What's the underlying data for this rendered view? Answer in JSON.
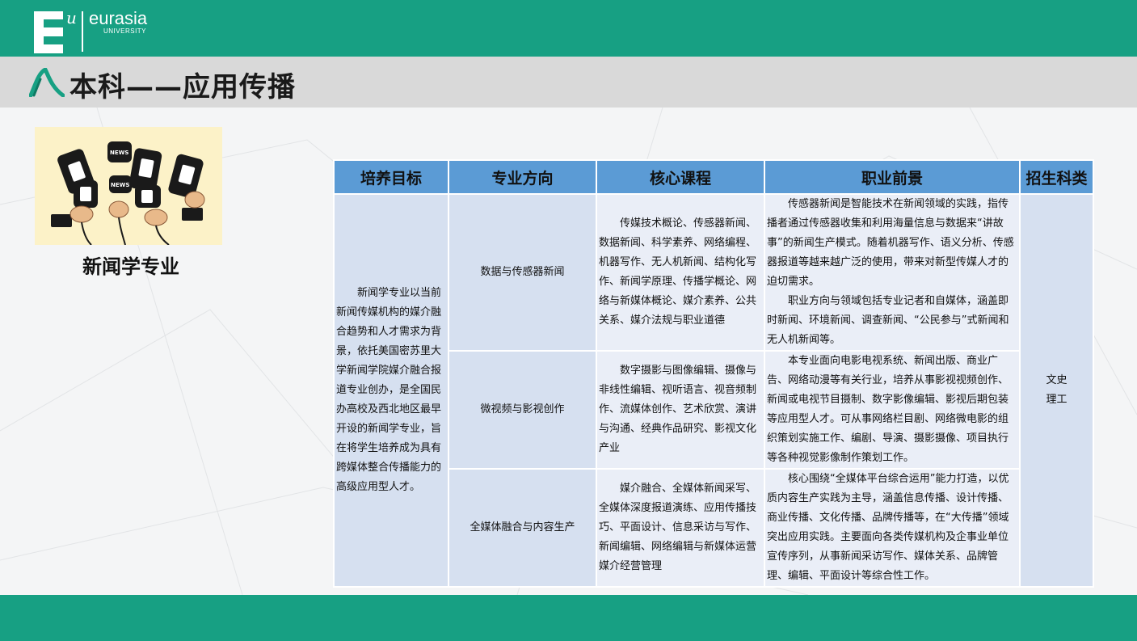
{
  "header": {
    "logo_mark": "E",
    "logo_sup": "u",
    "logo_name": "eurasia",
    "logo_sub": "UNIVERSITY",
    "brand_color": "#17a083"
  },
  "page_title": "本科——应用传播",
  "image_caption": "新闻学专业",
  "table": {
    "headers": [
      "培养目标",
      "专业方向",
      "核心课程",
      "职业前景",
      "招生科类"
    ],
    "goal": "新闻学专业以当前新闻传媒机构的媒介融合趋势和人才需求为背景，依托美国密苏里大学新闻学院媒介融合报道专业创办，是全国民办高校及西北地区最早开设的新闻学专业，旨在将学生培养成为具有跨媒体整合传播能力的高级应用型人才。",
    "subject_line1": "文史",
    "subject_line2": "理工",
    "rows": [
      {
        "direction": "数据与传感器新闻",
        "courses": "传媒技术概论、传感器新闻、数据新闻、科学素养、网络编程、机器写作、无人机新闻、结构化写作、新闻学原理、传播学概论、网络与新媒体概论、媒介素养、公共关系、媒介法规与职业道德",
        "career_p1": "传感器新闻是智能技术在新闻领域的实践，指传播者通过传感器收集和利用海量信息与数据来“讲故事”的新闻生产模式。随着机器写作、语义分析、传感器报道等越来越广泛的使用，带来对新型传媒人才的迫切需求。",
        "career_p2": "职业方向与领域包括专业记者和自媒体，涵盖即时新闻、环境新闻、调查新闻、“公民参与”式新闻和无人机新闻等。"
      },
      {
        "direction": "微视频与影视创作",
        "courses": "数字摄影与图像编辑、摄像与非线性编辑、视听语言、视音频制作、流媒体创作、艺术欣赏、演讲与沟通、经典作品研究、影视文化产业",
        "career_p1": "本专业面向电影电视系统、新闻出版、商业广告、网络动漫等有关行业，培养从事影视视频创作、新闻或电视节目摄制、数字影像编辑、影视后期包装等应用型人才。可从事网络栏目剧、网络微电影的组织策划实施工作、编剧、导演、摄影摄像、项目执行等各种视觉影像制作策划工作。",
        "career_p2": ""
      },
      {
        "direction": "全媒体融合与内容生产",
        "courses": "媒介融合、全媒体新闻采写、全媒体深度报道演练、应用传播技巧、平面设计、信息采访与写作、新闻编辑、网络编辑与新媒体运营媒介经营管理",
        "career_p1": "核心围绕“全媒体平台综合运用”能力打造，以优质内容生产实践为主导，涵盖信息传播、设计传播、商业传播、文化传播、品牌传播等，在“大传播”领域突出应用实践。主要面向各类传媒机构及企事业单位宣传序列，从事新闻采访写作、媒体关系、品牌管理、编辑、平面设计等综合性工作。",
        "career_p2": ""
      }
    ]
  },
  "colors": {
    "header_cell": "#5b9bd5",
    "body_cell_dark": "#d6e0f0",
    "body_cell_light": "#eaeef7",
    "title_bar": "#d9d9d9"
  }
}
